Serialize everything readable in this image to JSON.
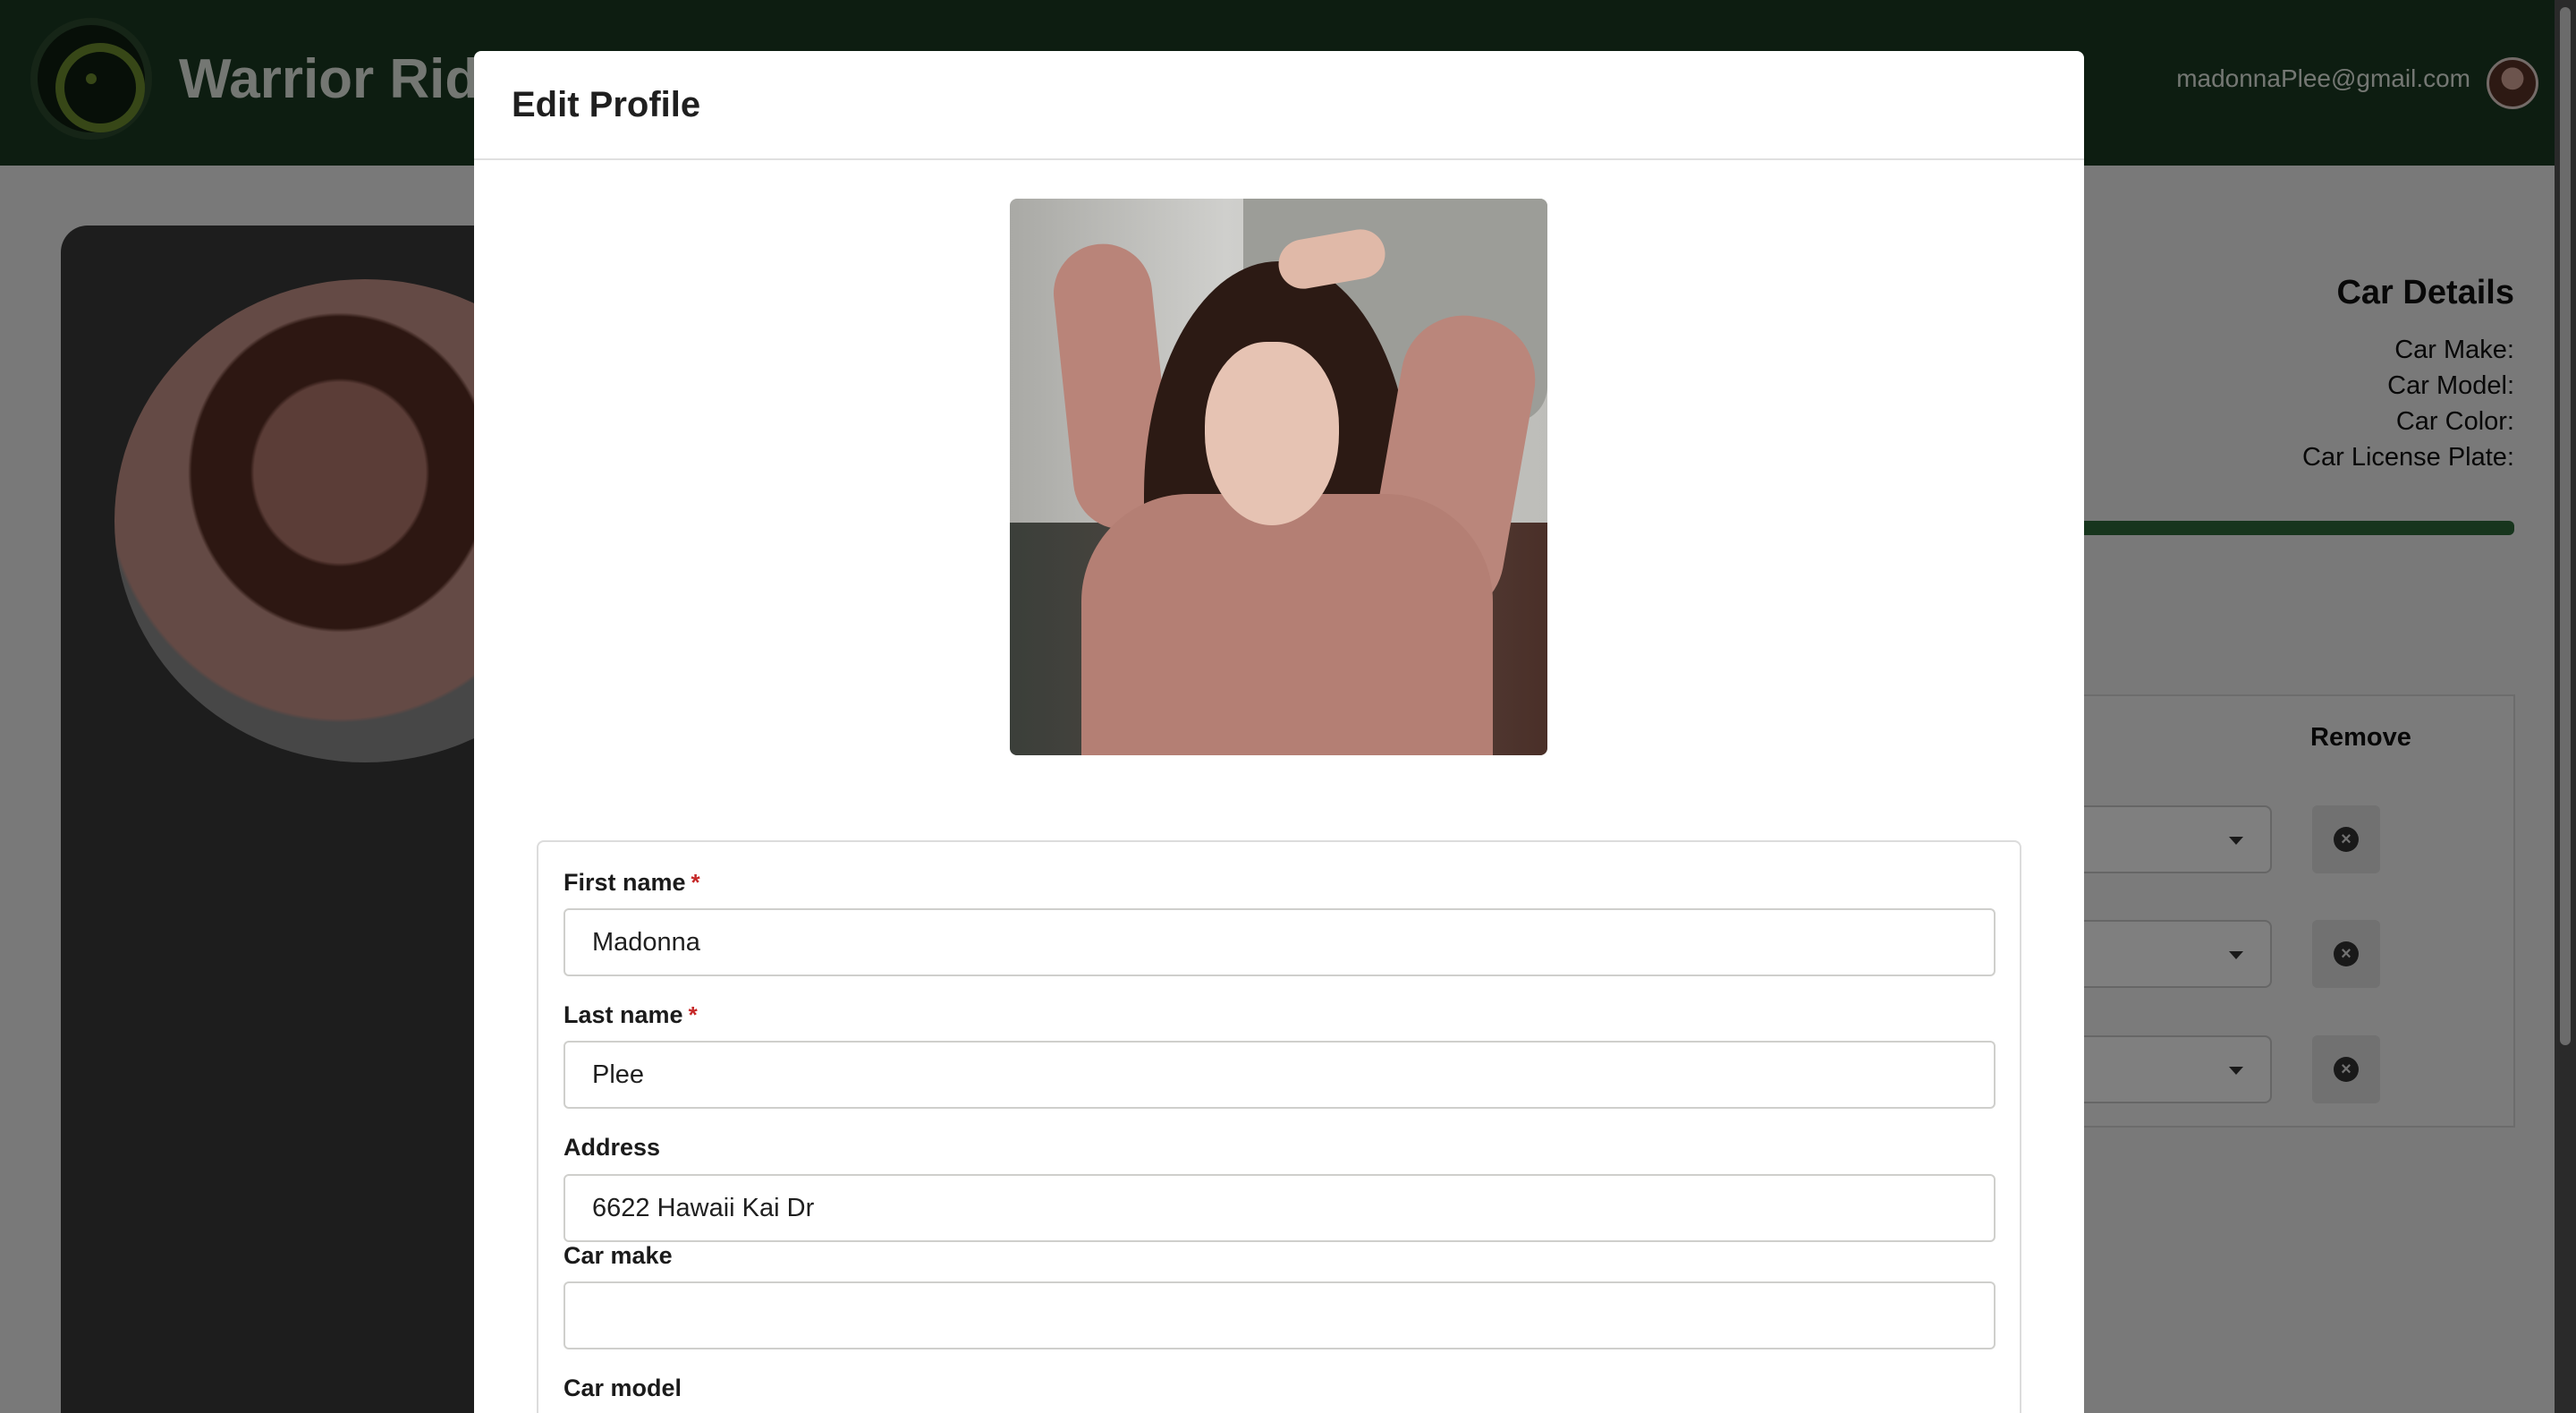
{
  "app": {
    "brand": "Warrior Ride",
    "user_email": "madonnaPlee@gmail.com"
  },
  "car_details": {
    "title": "Car Details",
    "make_label": "Car Make:",
    "model_label": "Car Model:",
    "color_label": "Car Color:",
    "plate_label": "Car License Plate:"
  },
  "remove_table": {
    "header": "Remove"
  },
  "modal": {
    "title": "Edit Profile",
    "fields": [
      {
        "label": "First name",
        "required": "*",
        "value": "Madonna"
      },
      {
        "label": "Last name",
        "required": "*",
        "value": "Plee"
      },
      {
        "label": "Address",
        "value": "6622 Hawaii Kai Dr"
      },
      {
        "label": "Car make",
        "value": ""
      },
      {
        "label": "Car model"
      }
    ]
  },
  "icons": {
    "remove": "close-circle-icon",
    "dropdown": "caret-down-icon",
    "logo": "steering-wheel-icon"
  },
  "colors": {
    "topbar": "#1b3b22",
    "required": "#c62828",
    "overlay": "rgba(0,0,0,0.5)"
  }
}
